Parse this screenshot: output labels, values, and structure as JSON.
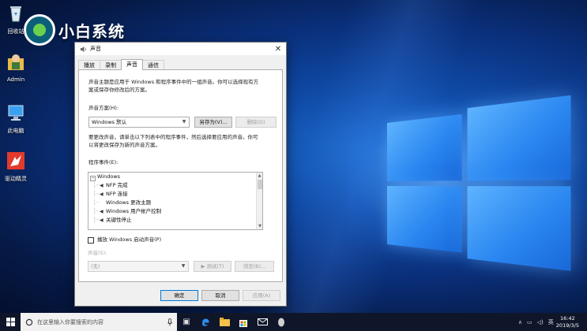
{
  "desktop": {
    "brand": "小白系统",
    "icons": [
      {
        "label": "回收站",
        "icon": "recycle-bin-icon"
      },
      {
        "label": "Admin",
        "icon": "user-folder-icon"
      },
      {
        "label": "此电脑",
        "icon": "computer-icon"
      },
      {
        "label": "驱动精灵",
        "icon": "driver-app-icon"
      }
    ]
  },
  "dialog": {
    "title": "声音",
    "tabs": [
      {
        "label": "播放",
        "active": false
      },
      {
        "label": "录制",
        "active": false
      },
      {
        "label": "声音",
        "active": true
      },
      {
        "label": "通信",
        "active": false
      }
    ],
    "description": [
      "声音主题是应用于 Windows 和程序事件中的一组声音。你可以选择现有方",
      "案或保存你修改后的方案。"
    ],
    "scheme_label": "声音方案(H):",
    "scheme_value": "Windows 默认",
    "save_as_label": "另存为(V)...",
    "delete_label": "删除(D)",
    "instructions": [
      "要更改声音，请单击以下列表中的程序事件，然后选择要应用的声音。你可",
      "以将更改保存为新的声音方案。"
    ],
    "events_label": "程序事件(E):",
    "events": [
      {
        "text": "Windows",
        "kind": "root"
      },
      {
        "text": "NFP 完成",
        "kind": "sound"
      },
      {
        "text": "NFP 连接",
        "kind": "sound"
      },
      {
        "text": "Windows 更改主题",
        "kind": "plain"
      },
      {
        "text": "Windows 用户帐户控制",
        "kind": "sound"
      },
      {
        "text": "关键性停止",
        "kind": "sound"
      }
    ],
    "startup_checkbox_label": "播放 Windows 启动声音(P)",
    "sounds_label": "声音(S):",
    "sounds_value": "(无)",
    "test_label": "▶ 测试(T)",
    "browse_label": "浏览(B)...",
    "ok_label": "确定",
    "cancel_label": "取消",
    "apply_label": "应用(A)"
  },
  "taskbar": {
    "search_placeholder": "在这里输入你要搜索的内容",
    "tray_lang": "英",
    "clock_time": "16:42",
    "clock_date": "2019/3/5"
  }
}
